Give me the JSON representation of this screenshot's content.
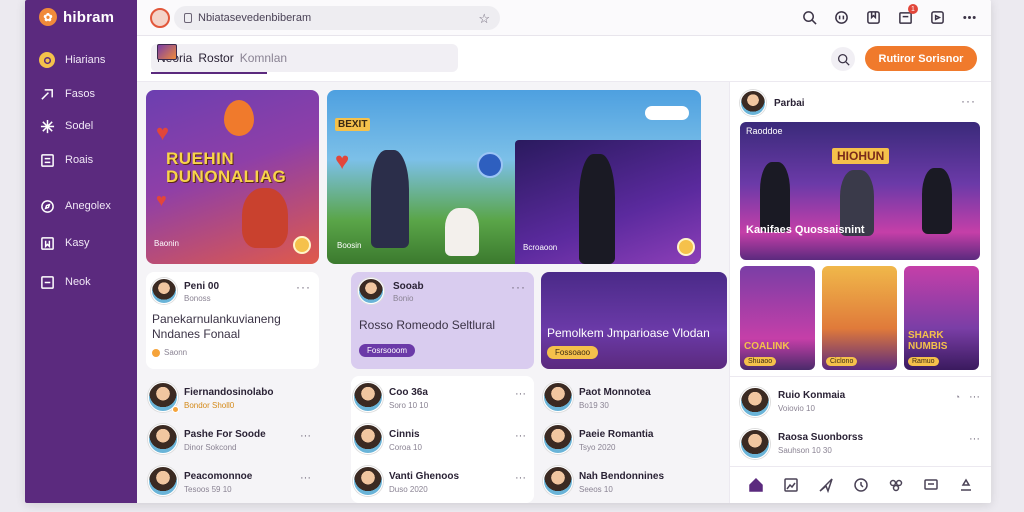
{
  "brand": {
    "name": "hibram",
    "logo_icon": "brand-logo-icon"
  },
  "sidebar": {
    "items": [
      {
        "label": "Hiarians",
        "icon": "home-dot-icon"
      },
      {
        "label": "Fasos",
        "icon": "share-icon"
      },
      {
        "label": "Sodel",
        "icon": "sparkle-icon"
      },
      {
        "label": "Roais",
        "icon": "list-icon"
      },
      {
        "label": "Anegolex",
        "icon": "compass-icon"
      },
      {
        "label": "Kasy",
        "icon": "bookmark-icon"
      },
      {
        "label": "Neok",
        "icon": "layers-icon"
      }
    ]
  },
  "topbar": {
    "url": "Nbiatasevedenbiberam",
    "icons": [
      "search-icon",
      "chat-icon",
      "book-icon",
      "notification-icon",
      "download-icon",
      "more-icon"
    ],
    "notification_count": "1"
  },
  "subbar": {
    "tab_title": "Neoria",
    "tab_sub": "Rostor",
    "tab_muted": "Komnlan",
    "cta_label": "Rutiror Sorisnor"
  },
  "hero": {
    "left_title": "RUEHIN DUNONALIAG",
    "left_caption": "Baonin",
    "mid_tag": "BEXIT",
    "mid_caption": "Boosin",
    "right_caption": "Bcroaoon"
  },
  "posts": [
    {
      "name": "Peni 00",
      "sub": "Bonoss",
      "text": "Panekarnulankuvianeng Nndanes Fonaal",
      "chip": "Saonn"
    },
    {
      "name": "Sooab",
      "sub": "Bonio",
      "text": "Rosso Romeodo Seltlural",
      "chip": "Fosrsooom"
    },
    {
      "name": "",
      "sub": "",
      "text": "Pemolkem Jmparioase Vlodan",
      "chip": "Fossoaoo"
    }
  ],
  "list1": [
    {
      "name": "Fiernandosinolabo",
      "sub": "Bondor Sholl0"
    },
    {
      "name": "Pashe For Soode",
      "sub": "Dinor Sokcond"
    },
    {
      "name": "Peacomonnoe",
      "sub": "Tesoos 59 10"
    }
  ],
  "list2": [
    {
      "name": "Coo 36a",
      "sub": "Soro 10 10"
    },
    {
      "name": "Cinnis",
      "sub": "Coroa 10"
    },
    {
      "name": "Vanti Ghenoos",
      "sub": "Duso 2020"
    }
  ],
  "list3": [
    {
      "name": "Paot Monnotea",
      "sub": "Bo19 30"
    },
    {
      "name": "Paeie Romantia",
      "sub": "Tsyo 2020"
    },
    {
      "name": "Nah Bendonnines",
      "sub": "Seeos 10"
    }
  ],
  "right": {
    "user": "Parbai",
    "banner_cap": "Raoddoe",
    "banner_tag": "HIOHUN",
    "banner_text": "Kanifaes Quossaisnint",
    "thumbs": [
      {
        "title": "COALINK",
        "chip": "Shuaoo"
      },
      {
        "title": "",
        "chip": "Ciclono"
      },
      {
        "title": "SHARK NUMBIS",
        "chip": "Ramuo"
      }
    ],
    "list": [
      {
        "name": "Ruio Konmaia",
        "sub": "Voiovio 10"
      },
      {
        "name": "Raosa Suonborss",
        "sub": "Sauhson 10 30"
      }
    ],
    "bottom_nav": [
      "home-icon",
      "image-icon",
      "send-icon",
      "clock-icon",
      "group-icon",
      "chat-bubble-icon",
      "profile-icon"
    ]
  },
  "colors": {
    "sidebar": "#5b2a7e",
    "accent": "#f07a2c",
    "gold": "#f5c14b"
  }
}
